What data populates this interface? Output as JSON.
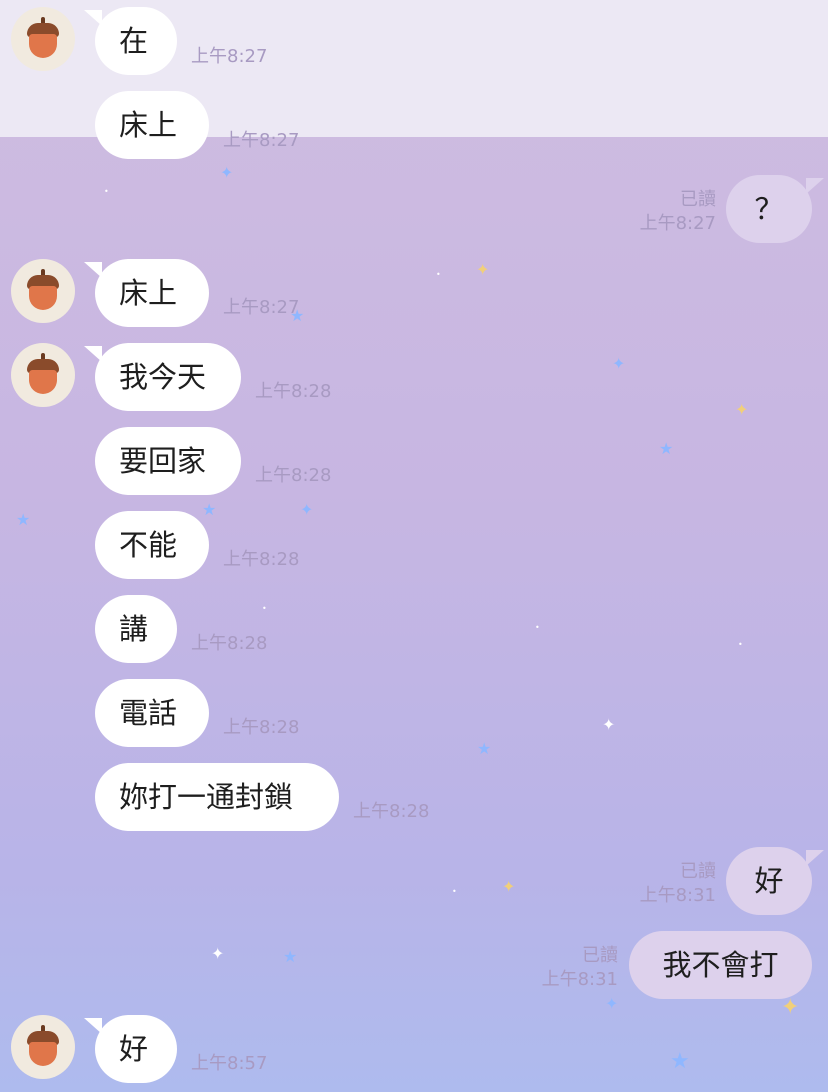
{
  "messages": [
    {
      "text": "在",
      "time": "上午8:27"
    },
    {
      "text": "床上",
      "time": "上午8:27"
    },
    {
      "text": "？",
      "time": "上午8:27",
      "read": "已讀"
    },
    {
      "text": "床上",
      "time": "上午8:27"
    },
    {
      "text": "我今天",
      "time": "上午8:28"
    },
    {
      "text": "要回家",
      "time": "上午8:28"
    },
    {
      "text": "不能",
      "time": "上午8:28"
    },
    {
      "text": "講",
      "time": "上午8:28"
    },
    {
      "text": "電話",
      "time": "上午8:28"
    },
    {
      "text": "妳打一通封鎖",
      "time": "上午8:28"
    },
    {
      "text": "好",
      "time": "上午8:31",
      "read": "已讀"
    },
    {
      "text": "我不會打",
      "time": "上午8:31",
      "read": "已讀"
    },
    {
      "text": "好",
      "time": "上午8:57"
    }
  ],
  "colors": {
    "incoming_bubble": "#ffffff",
    "outgoing_bubble": "#ddd1ec",
    "timestamp": "#a89ac2",
    "background_top": "#ece8f4"
  },
  "icons": {
    "avatar": "acorn-avatar-icon",
    "decor": "star-sparkle-icon"
  }
}
